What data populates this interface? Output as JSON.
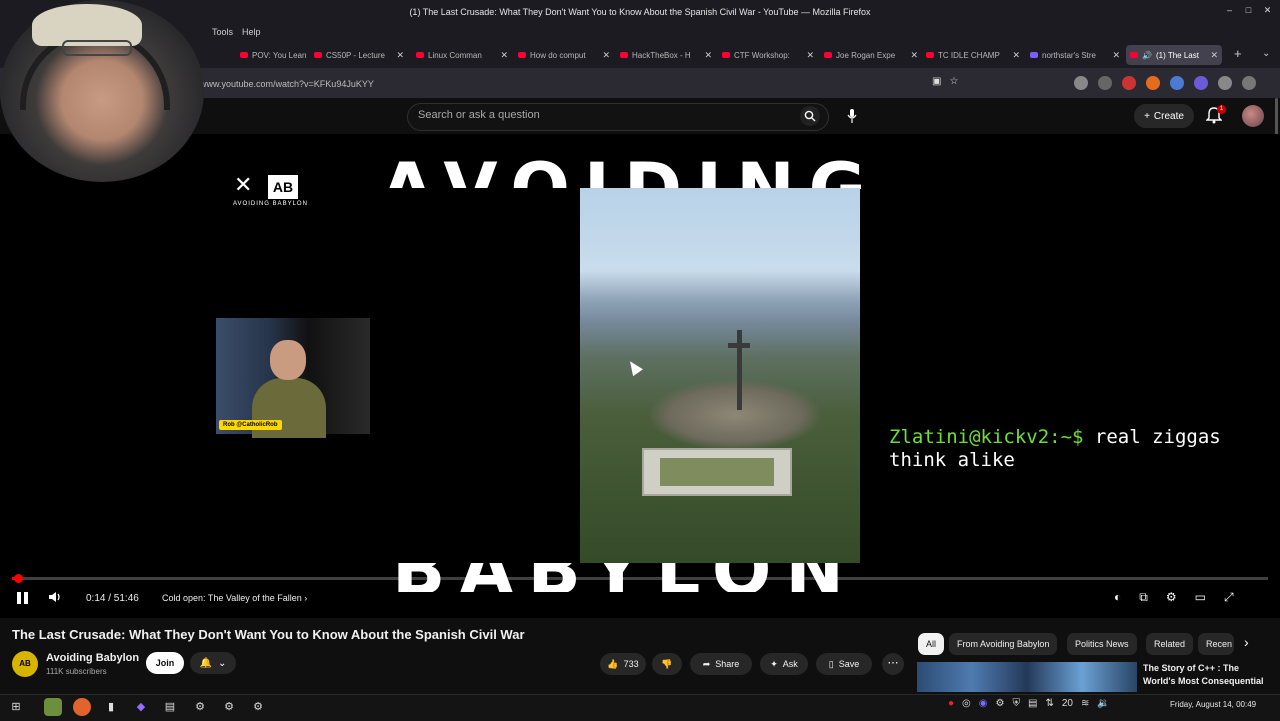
{
  "window": {
    "title": "(1) The Last Crusade: What They Don't Want You to Know About the Spanish Civil War - YouTube — Mozilla Firefox",
    "controls": [
      "–",
      "□",
      "✕"
    ]
  },
  "menu": {
    "tools": "Tools",
    "help": "Help"
  },
  "tabs": [
    {
      "label": "POV: You Learn"
    },
    {
      "label": "CS50P - Lecture"
    },
    {
      "label": "Linux Comman"
    },
    {
      "label": "How do comput"
    },
    {
      "label": "HackTheBox - H"
    },
    {
      "label": "CTF Workshop:"
    },
    {
      "label": "Joe Rogan Expe"
    },
    {
      "label": "TC IDLE CHAMP"
    },
    {
      "label": "northstar's Stre"
    },
    {
      "label": "(1) The Last"
    }
  ],
  "browser": {
    "url": "www.youtube.com/watch?v=KFKu94JuKYY",
    "new_tab": "+",
    "tab_menu": "⌄"
  },
  "masthead": {
    "search_placeholder": "Search or ask a question",
    "create_label": "Create",
    "notif_count": "1"
  },
  "video": {
    "bg_word_top": "AVOIDING",
    "bg_word_bottom": "BABYLON",
    "logo_mark": "✕",
    "logo_ab": "AB",
    "logo_text": "AVOIDING BABYLON",
    "guest_name": "Rob @CatholicRob",
    "overlay_prompt": "Zlatini@kickv2:~$",
    "overlay_message": " real ziggas think alike"
  },
  "player": {
    "progress_fraction": 0.0045,
    "time": "0:14 / 51:46",
    "chapter": "Cold open: The Valley of the Fallen",
    "chapter_chevron": "›"
  },
  "watch": {
    "title": "The Last Crusade: What They Don't Want You to Know About the Spanish Civil War",
    "channel_avatar": "AB",
    "channel_name": "Avoiding Babylon",
    "subscribers": "111K subscribers",
    "join_label": "Join",
    "like_count": "733",
    "share_label": "Share",
    "ask_label": "Ask",
    "save_label": "Save",
    "more_label": "⋯"
  },
  "chips": [
    {
      "label": "All",
      "selected": true
    },
    {
      "label": "From Avoiding Babylon",
      "selected": false
    },
    {
      "label": "Politics News",
      "selected": false
    },
    {
      "label": "Related",
      "selected": false
    },
    {
      "label": "Recen",
      "selected": false
    }
  ],
  "recommendation": {
    "title": "The Story of C++ : The World's Most Consequential"
  },
  "taskbar": {
    "network_speed": "20",
    "clock": "Friday, August 14, 00:49"
  },
  "colors": {
    "accent_red": "#ff0000",
    "terminal_green": "#6fe033",
    "yt_bg": "#0f0f0f"
  }
}
